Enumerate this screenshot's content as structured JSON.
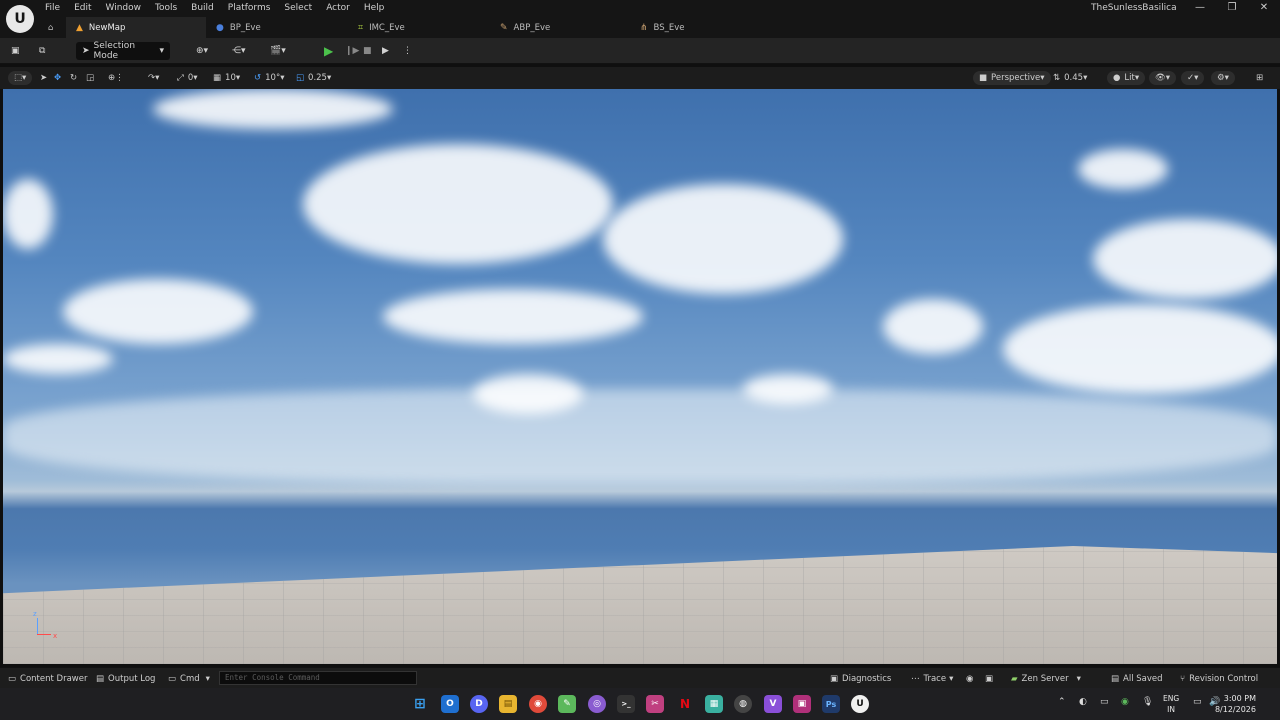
{
  "app": {
    "logo_text": "U",
    "project_name": "TheSunlessBasilica",
    "menu": [
      "File",
      "Edit",
      "Window",
      "Tools",
      "Build",
      "Platforms",
      "Select",
      "Actor",
      "Help"
    ],
    "window_controls": [
      "—",
      "❐",
      "✕"
    ]
  },
  "tabs": [
    {
      "label": "NewMap",
      "icon": "map-icon",
      "glyph": "▲",
      "color": "#f0a030"
    },
    {
      "label": "BP_Eve",
      "icon": "person-icon",
      "glyph": "●",
      "color": "#4a7fdc"
    },
    {
      "label": "IMC_Eve",
      "icon": "input-icon",
      "glyph": "⌗",
      "color": "#a8c840"
    },
    {
      "label": "ABP_Eve",
      "icon": "anim-icon",
      "glyph": "✎",
      "color": "#c8a070"
    },
    {
      "label": "BS_Eve",
      "icon": "blendspace-icon",
      "glyph": "⋔",
      "color": "#c8a070"
    }
  ],
  "toolbar": {
    "save_glyph": "💾",
    "mode_label": "Selection Mode",
    "play_glyphs": [
      "▶",
      "❙▶",
      "■",
      "▶"
    ]
  },
  "viewport_toolbar": {
    "grid_snap": "10",
    "rotation_snap": "10°",
    "scale_snap": "0.25",
    "camera_speed_value": "0",
    "view_mode": "Perspective",
    "fov_value": "0.45",
    "lighting": "Lit"
  },
  "statusbar": {
    "content_drawer": "Content Drawer",
    "output_log": "Output Log",
    "cmd": "Cmd",
    "console_placeholder": "Enter Console Command",
    "diagnostics": "Diagnostics",
    "trace": "Trace",
    "zen_server": "Zen Server",
    "all_saved": "All Saved",
    "revision_control": "Revision Control"
  },
  "taskbar": {
    "apps": [
      {
        "name": "windows-start-icon",
        "glyph": "⊞",
        "color": "#3aa0f0"
      },
      {
        "name": "outlook-icon",
        "glyph": "O",
        "color": "#1f6fd0"
      },
      {
        "name": "discord-icon",
        "glyph": "D",
        "color": "#5865f2"
      },
      {
        "name": "file-explorer-icon",
        "glyph": "▤",
        "color": "#e8b530"
      },
      {
        "name": "chrome-icon",
        "glyph": "◉",
        "color": "#e04a3a"
      },
      {
        "name": "notepad-icon",
        "glyph": "✎",
        "color": "#5cb85c"
      },
      {
        "name": "github-icon",
        "glyph": "◎",
        "color": "#8a5cd0"
      },
      {
        "name": "terminal-icon",
        "glyph": ">_",
        "color": "#333"
      },
      {
        "name": "snipping-icon",
        "glyph": "✂",
        "color": "#c04080"
      },
      {
        "name": "netflix-icon",
        "glyph": "N",
        "color": "#e50914"
      },
      {
        "name": "calculator-icon",
        "glyph": "▦",
        "color": "#3ab0a0"
      },
      {
        "name": "obs-icon",
        "glyph": "◍",
        "color": "#444"
      },
      {
        "name": "visual-studio-icon",
        "glyph": "V",
        "color": "#8a4fd8"
      },
      {
        "name": "photo-editor-icon",
        "glyph": "▣",
        "color": "#b0307a"
      },
      {
        "name": "photoshop-icon",
        "glyph": "Ps",
        "color": "#1f3a6a"
      },
      {
        "name": "unreal-icon",
        "glyph": "U",
        "color": "#f0f0f0"
      }
    ],
    "lang_top": "ENG",
    "lang_bottom": "IN",
    "time": "3:00 PM",
    "date": "8/12/2026"
  }
}
